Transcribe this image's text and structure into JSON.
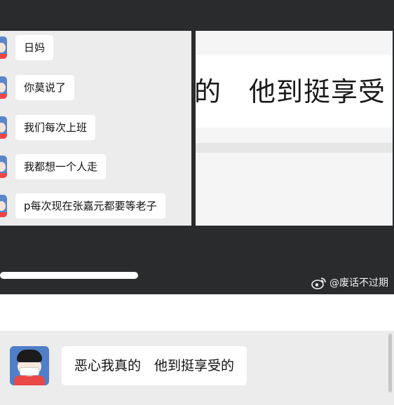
{
  "messages": [
    {
      "text": "日妈"
    },
    {
      "text": "你莫说了"
    },
    {
      "text": "我们每次上班"
    },
    {
      "text": "我都想一个人走"
    },
    {
      "text": "p每次现在张嘉元都要等老子"
    }
  ],
  "image_text": "的　他到挺享受",
  "watermark": "@废话不过期",
  "progress": 0.35,
  "reply": {
    "text": "恶心我真的　他到挺享受的"
  },
  "colors": {
    "background_dark": "#2a2b2d",
    "chat_bg": "#ececec",
    "bubble": "#ffffff",
    "avatar_blue": "#4f7fc7",
    "shirt_red": "#e84848"
  }
}
